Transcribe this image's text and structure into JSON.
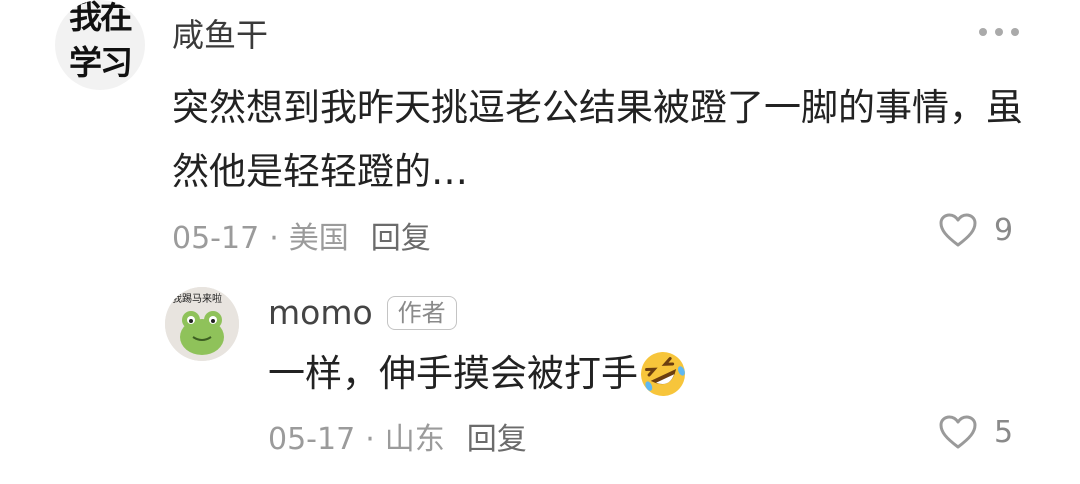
{
  "comment": {
    "avatar_text": "我在学习",
    "username": "咸鱼干",
    "text": "突然想到我昨天挑逗老公结果被蹬了一脚的事情，虽然他是轻轻蹬的…",
    "date": "05-17",
    "separator": "·",
    "location": "美国",
    "reply_label": "回复",
    "likes": "9"
  },
  "reply": {
    "avatar_tag": "我踢马来啦",
    "username": "momo",
    "author_badge": "作者",
    "text": "一样，伸手摸会被打手",
    "emoji": "rolling-on-floor-laughing",
    "date": "05-17",
    "separator": "·",
    "location": "山东",
    "reply_label": "回复",
    "likes": "5"
  },
  "colors": {
    "text_primary": "#222222",
    "text_secondary": "#9b9b9b",
    "emoji_yellow": "#f7c53b",
    "frog_green": "#8fc25a"
  },
  "icons": {
    "more": "more-dots-icon",
    "like": "heart-outline-icon"
  }
}
